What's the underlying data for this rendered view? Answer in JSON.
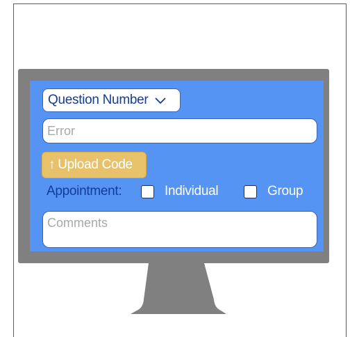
{
  "form": {
    "question_select": {
      "selected": "Question Number"
    },
    "error_field": {
      "placeholder": "Error"
    },
    "upload_button": {
      "label": "Upload Code",
      "icon": "arrow-up-icon"
    },
    "appointment": {
      "label": "Appointment:",
      "options": [
        {
          "label": "Individual",
          "checked": false
        },
        {
          "label": "Group",
          "checked": false
        }
      ]
    },
    "comments_field": {
      "placeholder": "Comments"
    }
  },
  "colors": {
    "screen": "#5594f2",
    "bezel": "#808080",
    "upload_button": "#e8c26b",
    "label_text": "#133c99"
  }
}
